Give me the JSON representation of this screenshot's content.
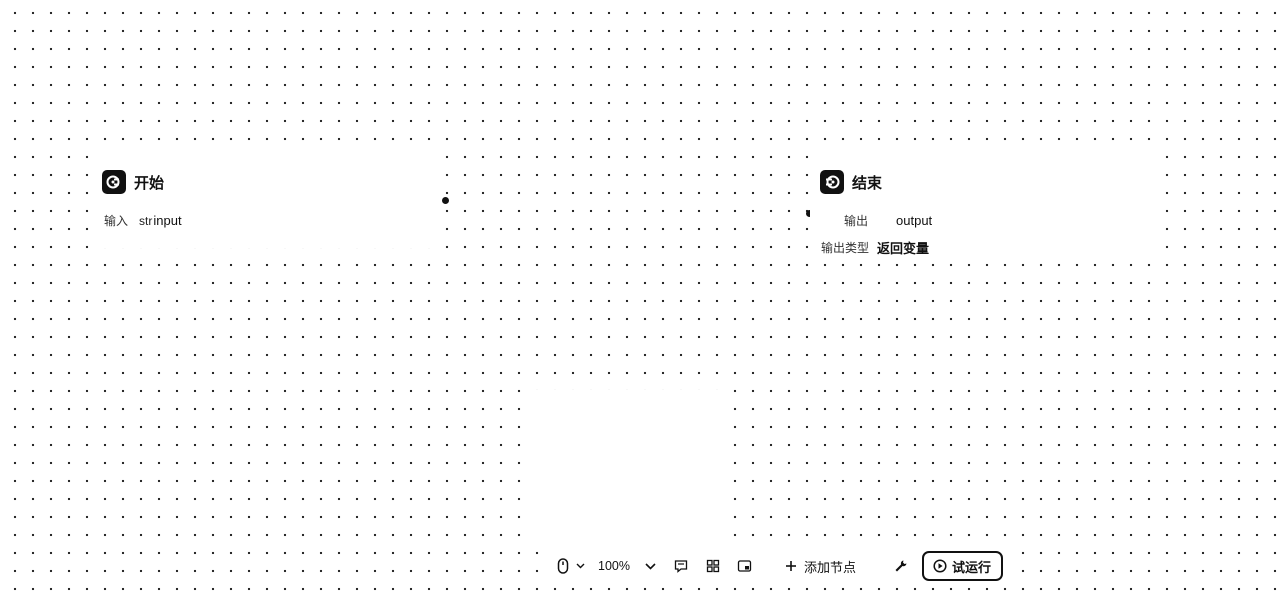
{
  "start_node": {
    "title": "开始",
    "icon": "start-node-icon",
    "input_label": "输入",
    "input_type": "str",
    "input_name": "input"
  },
  "end_node": {
    "title": "结束",
    "icon": "end-node-icon",
    "output_label": "输出",
    "output_name": "output",
    "output_type_label": "输出类型",
    "output_type_value": "返回变量"
  },
  "toolbar": {
    "zoom": "100%",
    "add_node_label": "添加节点",
    "run_label": "试运行"
  }
}
